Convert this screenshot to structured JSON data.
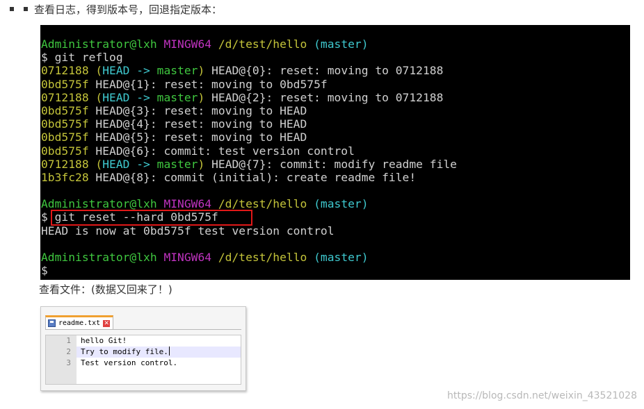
{
  "intro": {
    "text": "查看日志，得到版本号，回退指定版本："
  },
  "terminal": {
    "lines": [
      {
        "segments": [
          {
            "text": "Administrator@lxh ",
            "color": "green"
          },
          {
            "text": "MINGW64 ",
            "color": "magenta"
          },
          {
            "text": "/d/test/hello ",
            "color": "yellow"
          },
          {
            "text": "(master)",
            "color": "cyan"
          }
        ]
      },
      {
        "segments": [
          {
            "text": "$ git reflog",
            "color": "white"
          }
        ]
      },
      {
        "segments": [
          {
            "text": "0712188 ",
            "color": "hash"
          },
          {
            "text": "(",
            "color": "yellow"
          },
          {
            "text": "HEAD -> ",
            "color": "cyan"
          },
          {
            "text": "master",
            "color": "green"
          },
          {
            "text": ")",
            "color": "yellow"
          },
          {
            "text": " HEAD@{0}: reset: moving to 0712188",
            "color": "white"
          }
        ]
      },
      {
        "segments": [
          {
            "text": "0bd575f ",
            "color": "hash"
          },
          {
            "text": "HEAD@{1}: reset: moving to 0bd575f",
            "color": "white"
          }
        ]
      },
      {
        "segments": [
          {
            "text": "0712188 ",
            "color": "hash"
          },
          {
            "text": "(",
            "color": "yellow"
          },
          {
            "text": "HEAD -> ",
            "color": "cyan"
          },
          {
            "text": "master",
            "color": "green"
          },
          {
            "text": ")",
            "color": "yellow"
          },
          {
            "text": " HEAD@{2}: reset: moving to 0712188",
            "color": "white"
          }
        ]
      },
      {
        "segments": [
          {
            "text": "0bd575f ",
            "color": "hash"
          },
          {
            "text": "HEAD@{3}: reset: moving to HEAD",
            "color": "white"
          }
        ]
      },
      {
        "segments": [
          {
            "text": "0bd575f ",
            "color": "hash"
          },
          {
            "text": "HEAD@{4}: reset: moving to HEAD",
            "color": "white"
          }
        ]
      },
      {
        "segments": [
          {
            "text": "0bd575f ",
            "color": "hash"
          },
          {
            "text": "HEAD@{5}: reset: moving to HEAD",
            "color": "white"
          }
        ]
      },
      {
        "segments": [
          {
            "text": "0bd575f ",
            "color": "hash"
          },
          {
            "text": "HEAD@{6}: commit: test version control",
            "color": "white"
          }
        ]
      },
      {
        "segments": [
          {
            "text": "0712188 ",
            "color": "hash"
          },
          {
            "text": "(",
            "color": "yellow"
          },
          {
            "text": "HEAD -> ",
            "color": "cyan"
          },
          {
            "text": "master",
            "color": "green"
          },
          {
            "text": ")",
            "color": "yellow"
          },
          {
            "text": " HEAD@{7}: commit: modify readme file",
            "color": "white"
          }
        ]
      },
      {
        "segments": [
          {
            "text": "1b3fc28 ",
            "color": "hash"
          },
          {
            "text": "HEAD@{8}: commit (initial): create readme file!",
            "color": "white"
          }
        ]
      },
      {
        "segments": []
      },
      {
        "segments": [
          {
            "text": "Administrator@lxh ",
            "color": "green"
          },
          {
            "text": "MINGW64 ",
            "color": "magenta"
          },
          {
            "text": "/d/test/hello ",
            "color": "yellow"
          },
          {
            "text": "(master)",
            "color": "cyan"
          }
        ]
      },
      {
        "segments": [
          {
            "text": "$ git reset --hard 0bd575f",
            "color": "white"
          }
        ]
      },
      {
        "segments": [
          {
            "text": "HEAD is now at 0bd575f test version control",
            "color": "white"
          }
        ]
      },
      {
        "segments": []
      },
      {
        "segments": [
          {
            "text": "Administrator@lxh ",
            "color": "green"
          },
          {
            "text": "MINGW64 ",
            "color": "magenta"
          },
          {
            "text": "/d/test/hello ",
            "color": "yellow"
          },
          {
            "text": "(master)",
            "color": "cyan"
          }
        ]
      },
      {
        "segments": [
          {
            "text": "$",
            "color": "white"
          }
        ]
      }
    ],
    "colors": {
      "background": "#000000",
      "green": "#3fc73f",
      "magenta": "#c033c0",
      "yellow": "#c4c43a",
      "cyan": "#3fc9cf",
      "white": "#d0d0d0",
      "highlight_border": "#e01818"
    }
  },
  "caption": {
    "text": "查看文件：(数据又回来了！)"
  },
  "editor": {
    "tab_label": "readme.txt",
    "close_glyph": "✕",
    "lines": [
      {
        "number": "1",
        "text": "hello Git!",
        "current": false
      },
      {
        "number": "2",
        "text": "Try to modify file.",
        "current": true
      },
      {
        "number": "3",
        "text": "Test version control.",
        "current": false
      }
    ],
    "tab_accent": "#f0a030",
    "current_line_color": "#e8e8ff"
  },
  "watermark": {
    "text": "https://blog.csdn.net/weixin_43521028"
  }
}
